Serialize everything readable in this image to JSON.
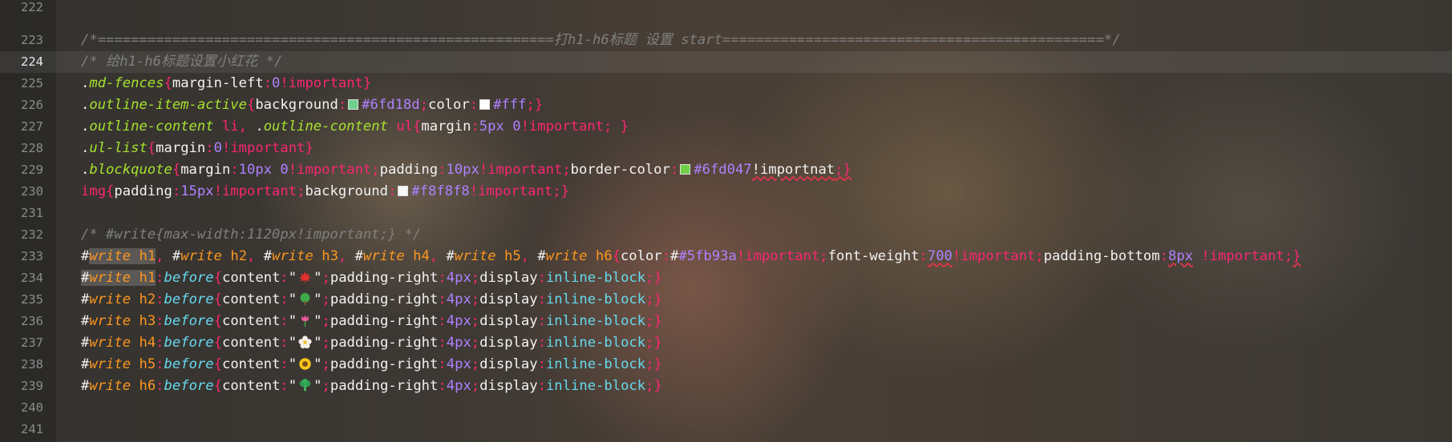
{
  "editor": {
    "current_line": "224",
    "swatch_colors": {
      "green_bg": "#6fd18d",
      "white": "#ffffff",
      "green_border": "#6fd047",
      "light_gray": "#f8f8f8"
    },
    "emoji_icons": [
      "maple-leaf-icon",
      "tree-icon",
      "tulip-icon",
      "blossom-icon",
      "sunflower-icon",
      "broccoli-icon"
    ],
    "lines": [
      {
        "n": "222"
      },
      {
        "n": "223",
        "comment": "/*=======================================================打h1-h6标题 设置 start==============================================*/"
      },
      {
        "n": "224",
        "comment": "/* 给h1-h6标题设置小红花 */"
      },
      {
        "n": "225",
        "sel": "md-fences",
        "prop": "margin-left",
        "num": "0",
        "imp": "!important"
      },
      {
        "n": "226",
        "sel": "outline-item-active",
        "prop1": "background",
        "hex1": "#6fd18d",
        "prop2": "color",
        "hex2": "#fff"
      },
      {
        "n": "227",
        "sel_a": "outline-content",
        "tag_a": "li",
        "sel_b": "outline-content",
        "tag_b": "ul",
        "prop": "margin",
        "num1": "5px",
        "num2": "0",
        "imp": "!important"
      },
      {
        "n": "228",
        "sel": "ul-list",
        "prop": "margin",
        "num": "0",
        "imp": "!important"
      },
      {
        "n": "229",
        "sel": "blockquote",
        "prop1": "margin",
        "num1": "10px",
        "num2": "0",
        "imp1": "!important",
        "prop2": "padding",
        "num3": "10px",
        "imp2": "!important",
        "prop3": "border-color",
        "hex": "#6fd047",
        "imp3": "!importnat"
      },
      {
        "n": "230",
        "tag": "img",
        "prop1": "padding",
        "num": "15px",
        "imp1": "!important",
        "prop2": "background",
        "hex": "#f8f8f8",
        "imp2": "!important"
      },
      {
        "n": "231"
      },
      {
        "n": "232",
        "comment": "/* #write{max-width:1120px!important;} */"
      },
      {
        "n": "233",
        "prop1": "color",
        "hex": "#5fb93a",
        "imp1": "!important",
        "prop2": "font-weight",
        "num1": "700",
        "imp2": "!important",
        "prop3": "padding-bottom",
        "num2": "8px",
        "imp3": "!important"
      },
      {
        "n": "234",
        "h": "h1",
        "ps": "before",
        "prop1": "content",
        "prop2": "padding-right",
        "num": "4px",
        "prop3": "display",
        "val": "inline-block"
      },
      {
        "n": "235",
        "h": "h2",
        "ps": "before",
        "prop1": "content",
        "prop2": "padding-right",
        "num": "4px",
        "prop3": "display",
        "val": "inline-block"
      },
      {
        "n": "236",
        "h": "h3",
        "ps": "before",
        "prop1": "content",
        "prop2": "padding-right",
        "num": "4px",
        "prop3": "display",
        "val": "inline-block"
      },
      {
        "n": "237",
        "h": "h4",
        "ps": "before",
        "prop1": "content",
        "prop2": "padding-right",
        "num": "4px",
        "prop3": "display",
        "val": "inline-block"
      },
      {
        "n": "238",
        "h": "h5",
        "ps": "before",
        "prop1": "content",
        "prop2": "padding-right",
        "num": "4px",
        "prop3": "display",
        "val": "inline-block"
      },
      {
        "n": "239",
        "h": "h6",
        "ps": "before",
        "prop1": "content",
        "prop2": "padding-right",
        "num": "4px",
        "prop3": "display",
        "val": "inline-block"
      },
      {
        "n": "240"
      },
      {
        "n": "241"
      }
    ],
    "write_id": "write",
    "headings": [
      "h1",
      "h2",
      "h3",
      "h4",
      "h5",
      "h6"
    ]
  }
}
